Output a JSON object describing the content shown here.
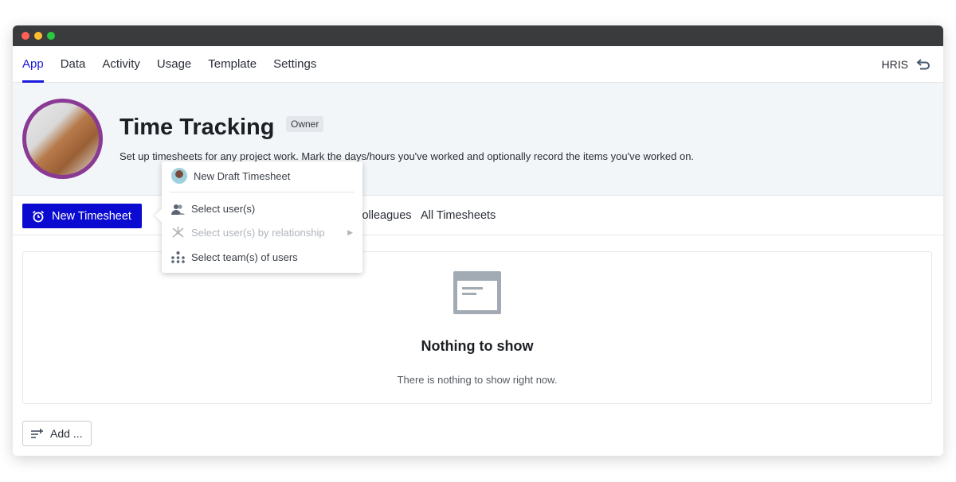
{
  "nav": {
    "tabs": [
      "App",
      "Data",
      "Activity",
      "Usage",
      "Template",
      "Settings"
    ],
    "active": "App",
    "right_label": "HRIS"
  },
  "header": {
    "title": "Time Tracking",
    "badge": "Owner",
    "description": "Set up timesheets for any project work. Mark the days/hours you've worked and optionally record the items you've worked on."
  },
  "toolbar": {
    "new_button": "New Timesheet",
    "tabs": [
      "Colleagues",
      "All Timesheets"
    ]
  },
  "menu": {
    "items": [
      {
        "label": "New Draft Timesheet",
        "icon": "user-avatar-icon",
        "disabled": false
      },
      {
        "label": "Select user(s)",
        "icon": "users-icon",
        "disabled": false
      },
      {
        "label": "Select user(s) by relationship",
        "icon": "relationship-icon",
        "disabled": true,
        "submenu": true
      },
      {
        "label": "Select team(s) of users",
        "icon": "team-icon",
        "disabled": false
      }
    ]
  },
  "empty": {
    "title": "Nothing to show",
    "text": "There is nothing to show right now."
  },
  "add_button": "Add ...",
  "colors": {
    "accent": "#0a0ad0",
    "avatar_ring": "#8a3a94"
  }
}
